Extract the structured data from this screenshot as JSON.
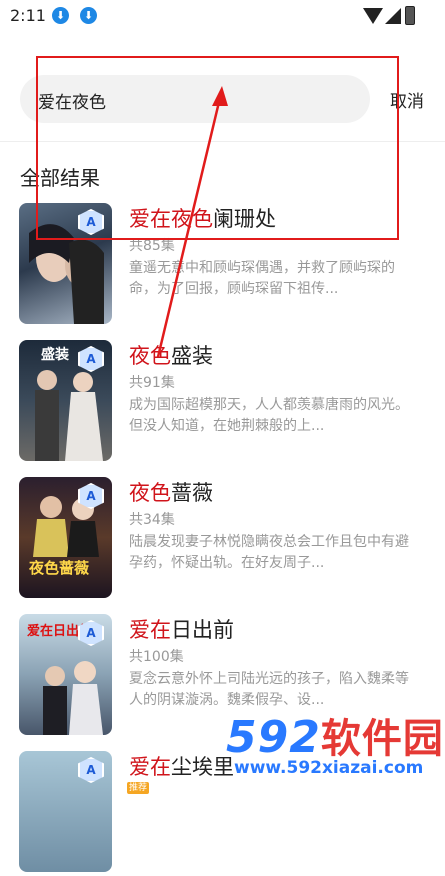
{
  "status_bar": {
    "time": "2:11"
  },
  "search": {
    "query": "爱在夜色",
    "cancel_label": "取消"
  },
  "section_title": "全部结果",
  "results": [
    {
      "title_highlight": "爱在夜色",
      "title_rest": "阑珊处",
      "count": "共85集",
      "description": "童遥无意中和顾屿琛偶遇，并救了顾屿琛的命，为了回报，顾屿琛留下祖传...",
      "badge": "A",
      "poster_text": ""
    },
    {
      "title_highlight": "夜色",
      "title_rest": "盛装",
      "count": "共91集",
      "description": "成为国际超模那天，人人都羡慕唐雨的风光。但没人知道，在她荆棘般的上...",
      "badge": "A",
      "poster_text": "盛装"
    },
    {
      "title_highlight": "夜色",
      "title_rest": "蔷薇",
      "count": "共34集",
      "description": "陆晨发现妻子林悦隐瞒夜总会工作且包中有避孕药，怀疑出轨。在好友周子...",
      "badge": "A",
      "poster_text": "夜色蔷薇"
    },
    {
      "title_highlight": "爱在",
      "title_rest": "日出前",
      "count": "共100集",
      "description": "夏念云意外怀上司陆光远的孩子，陷入魏柔等人的阴谋漩涡。魏柔假孕、设...",
      "badge": "A",
      "poster_text": "爱在日出前"
    },
    {
      "title_highlight": "爱在",
      "title_rest": "尘埃里",
      "count": "",
      "description": "",
      "badge": "A",
      "poster_text": ""
    }
  ],
  "watermark": {
    "brand_num": "592",
    "brand_text": "软件园",
    "url": "www.592xiazai.com",
    "tag": "推荐"
  },
  "colors": {
    "highlight": "#d0141b",
    "annotation": "#e11b1b",
    "watermark_blue": "#2979ff"
  }
}
